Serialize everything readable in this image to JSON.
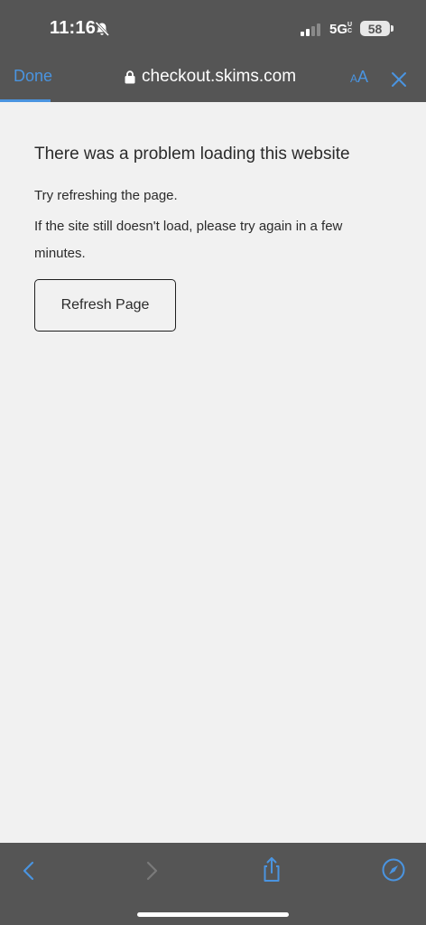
{
  "status_bar": {
    "time": "11:16",
    "network": "5G",
    "network_suffix": "UC",
    "battery": "58"
  },
  "browser": {
    "done_label": "Done",
    "url": "checkout.skims.com",
    "text_size_small": "A",
    "text_size_large": "A"
  },
  "page": {
    "title": "There was a problem loading this website",
    "line1": "Try refreshing the page.",
    "line2": "If the site still doesn't load, please try again in a few minutes.",
    "refresh_label": "Refresh Page"
  },
  "toolbar": {
    "icons": [
      "back-icon",
      "forward-icon",
      "share-icon",
      "compass-icon"
    ]
  },
  "colors": {
    "chrome": "#555555",
    "accent": "#4a94e0",
    "page_bg": "#f1f1f1",
    "text": "#2b2b2b"
  }
}
